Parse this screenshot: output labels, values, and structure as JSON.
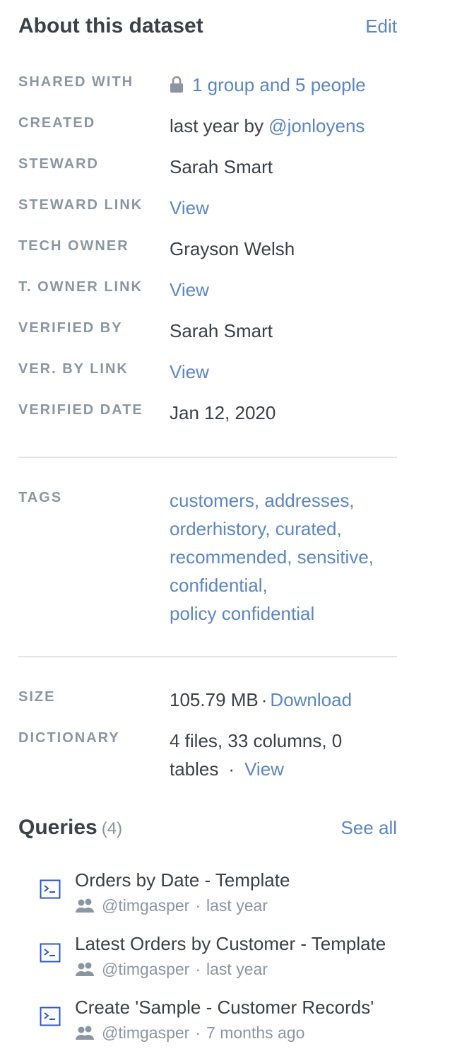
{
  "about": {
    "title": "About this dataset",
    "edit_label": "Edit",
    "shared_with": {
      "label": "SHARED WITH",
      "value": "1 group and 5 people"
    },
    "created": {
      "label": "CREATED",
      "value_prefix": "last year by ",
      "user": "@jonloyens"
    },
    "steward": {
      "label": "STEWARD",
      "value": "Sarah Smart"
    },
    "steward_link": {
      "label": "STEWARD LINK",
      "value": "View"
    },
    "tech_owner": {
      "label": "TECH OWNER",
      "value": "Grayson Welsh"
    },
    "t_owner_link": {
      "label": "T. OWNER LINK",
      "value": "View"
    },
    "verified_by": {
      "label": "VERIFIED BY",
      "value": "Sarah Smart"
    },
    "ver_by_link": {
      "label": "VER. BY LINK",
      "value": "View"
    },
    "verified_date": {
      "label": "VERIFIED DATE",
      "value": "Jan 12, 2020"
    }
  },
  "tags": {
    "label": "TAGS",
    "lines": [
      "customers, addresses,",
      "orderhistory, curated,",
      "recommended, sensitive,",
      "confidential,",
      "policy confidential"
    ]
  },
  "size": {
    "label": "SIZE",
    "value": "105.79 MB",
    "separator": "·",
    "download_label": "Download"
  },
  "dictionary": {
    "label": "DICTIONARY",
    "line1": "4 files, 33 columns, 0",
    "line2": "tables",
    "separator": "·",
    "view_label": "View"
  },
  "queries": {
    "title": "Queries",
    "count": "(4)",
    "see_all_label": "See all",
    "items": [
      {
        "title": "Orders by Date - Template",
        "user": "@timgasper",
        "separator": "·",
        "time": "last year"
      },
      {
        "title": "Latest Orders by Customer - Template",
        "user": "@timgasper",
        "separator": "·",
        "time": "last year"
      },
      {
        "title": "Create 'Sample - Customer Records'",
        "user": "@timgasper",
        "separator": "·",
        "time": "7 months ago"
      }
    ]
  },
  "colors": {
    "link": "#5b86c4",
    "label": "#8b96a4",
    "text": "#3b4148",
    "icon": "#2d56c7",
    "divider": "#e1e4e8"
  }
}
